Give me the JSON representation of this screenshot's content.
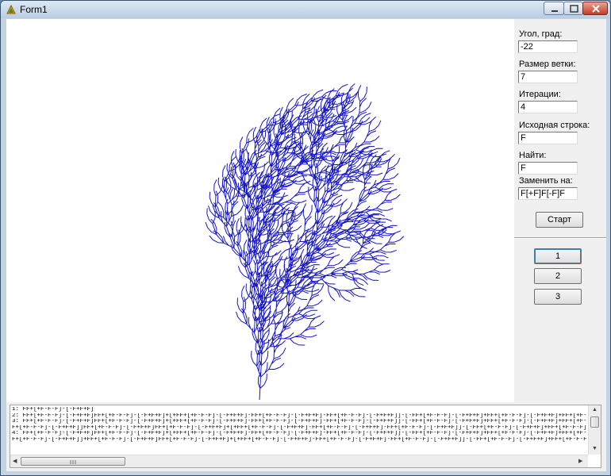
{
  "window": {
    "title": "Form1"
  },
  "panel": {
    "angle_label": "Угол, град:",
    "angle_value": "-22",
    "branch_size_label": "Размер ветки:",
    "branch_size_value": "7",
    "iterations_label": "Итерации:",
    "iterations_value": "4",
    "axiom_label": "Исходная строка:",
    "axiom_value": "F",
    "find_label": "Найти:",
    "find_value": "F",
    "replace_label": "Заменить на:",
    "replace_value": "F[+F]F[-F]F",
    "start_button": "Старт",
    "preset_buttons": [
      "1",
      "2",
      "3"
    ]
  },
  "memo": {
    "lines": [
      "1: FF+[+F-F-F]-[-F+F+F]",
      "2: FF+[+F-F-F]-[-F+F+F]FF+[+F-F-F]-[-F+F+F]+[+FF+[+F-F-F]-[-F+F+F]-FF+[+F-F-F]-[-F+F+F]-FF+[+F-F-F]-[-F+F+F]]-[-FF+[+F-F-F]-[-F+F+F]+FF+[+F-F-F]-[-F+F+F]+FF+[+F-F-F]-[-F+F+F]]",
      "3: FF+[+F-F-F]-[-F+F+F]FF+[+F-F-F]-[-F+F+F]+[+FF+[+F-F-F]-[-F+F+F]-FF+[+F-F-F]-[-F+F+F]-FF+[+F-F-F]-[-F+F+F]]-[-FF+[+F-F-F]-[-F+F+F]+FF+[+F-F-F]-[-F+F+F]+FF+[+F-F-F]-[-F+F+F]]FF+[+F",
      "F+[+F-F-F]-[-F+F+F]]FF+[+F-F-F]-[-F+F+F]FF+[+F-F-F]-[-F+F+F]+[+FF+[+F-F-F]-[-F+F+F]-FF+[+F-F-F]-[-F+F+F]-FF+[+F-F-F]-[-F+F+F]]-[-FF+[+F-F-F]-[-F+F+F]+FF+[+F-F-F]-[-F+F+F]+FF+[+F-F-",
      "4: FF+[+F-F-F]-[-F+F+F]FF+[+F-F-F]-[-F+F+F]+[+FF+[+F-F-F]-[-F+F+F]-FF+[+F-F-F]-[-F+F+F]-FF+[+F-F-F]-[-F+F+F]]-[-FF+[+F-F-F]-[-F+F+F]+FF+[+F-F-F]-[-F+F+F]+FF+[+F-F-F]-[-F+F+F]]FF+[+F",
      "F+[+F-F-F]-[-F+F+F]]+FF+[+F-F-F]-[-F+F+F]FF+[+F-F-F]-[-F+F+F]+[+FF+[+F-F-F]-[-F+F+F]-FF+[+F-F-F]-[-F+F+F]-FF+[+F-F-F]-[-F+F+F]]-[-FF+[+F-F-F]-[-F+F+F]+FF+[+F-F-F]-[-F+F+F]+FF+[+F-F-"
    ]
  },
  "colors": {
    "tree": "#1414c8",
    "canvas": "#ffffff"
  }
}
